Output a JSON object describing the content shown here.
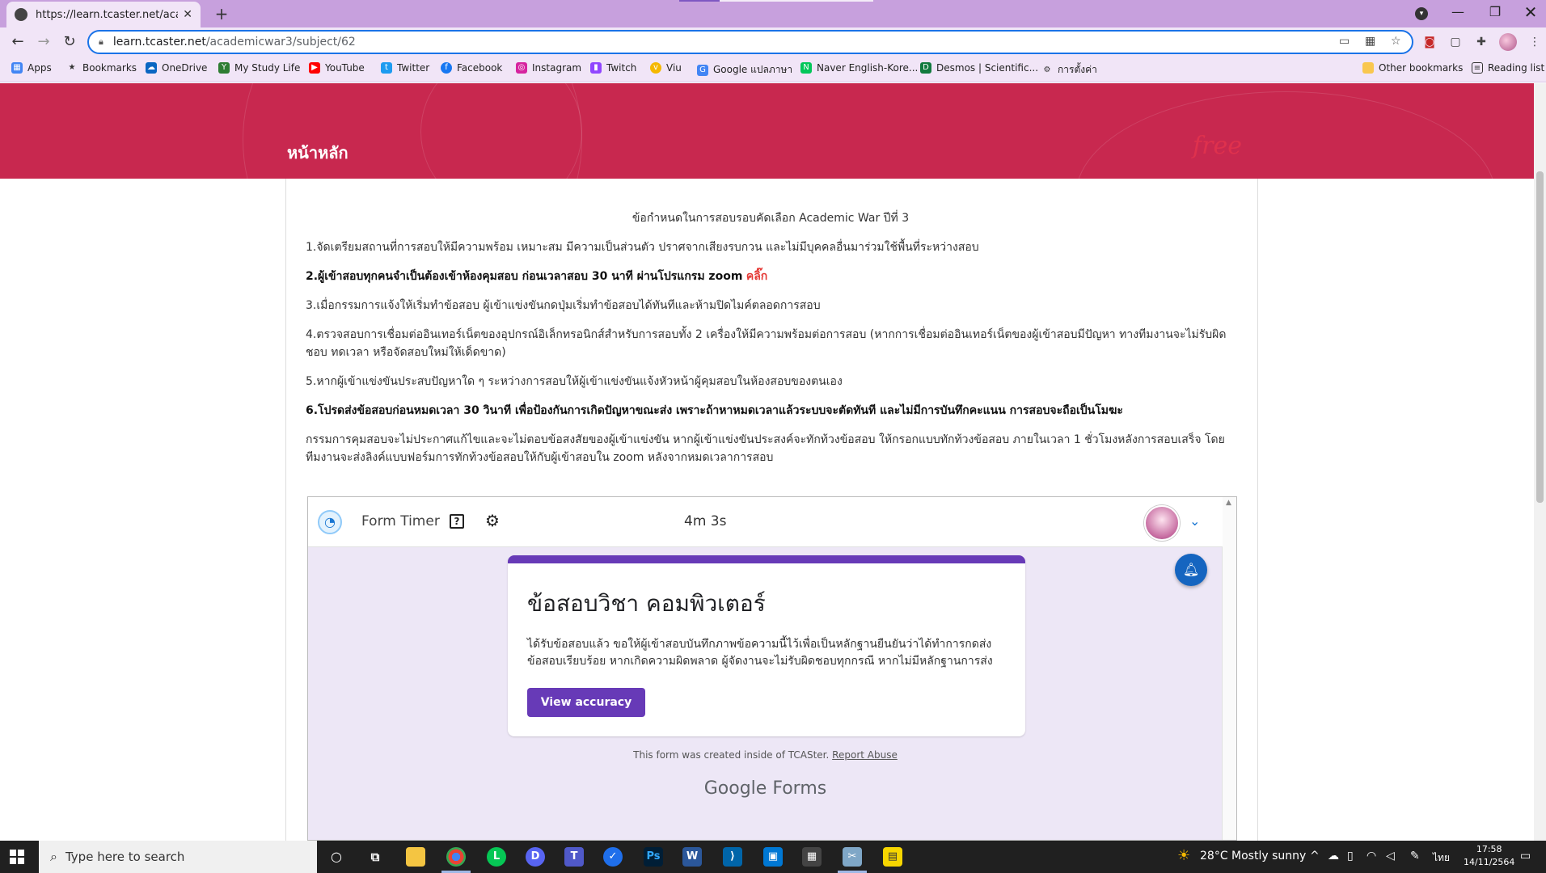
{
  "browser": {
    "tab_title": "https://learn.tcaster.net/academ",
    "url_host": "learn.tcaster.net",
    "url_path": "/academicwar3/subject/62",
    "bookmarks": [
      {
        "label": "Apps",
        "icon": "apps-grid-icon",
        "color": "#4285f4"
      },
      {
        "label": "Bookmarks",
        "icon": "star-icon",
        "color": "#333333"
      },
      {
        "label": "OneDrive",
        "icon": "cloud-icon",
        "color": "#0a66c2"
      },
      {
        "label": "My Study Life",
        "icon": "study-icon",
        "color": "#2e7d32"
      },
      {
        "label": "YouTube",
        "icon": "youtube-icon",
        "color": "#ff0000"
      },
      {
        "label": "Twitter",
        "icon": "twitter-icon",
        "color": "#1d9bf0"
      },
      {
        "label": "Facebook",
        "icon": "facebook-icon",
        "color": "#1877f2"
      },
      {
        "label": "Instagram",
        "icon": "instagram-icon",
        "color": "#d6249f"
      },
      {
        "label": "Twitch",
        "icon": "twitch-icon",
        "color": "#9146ff"
      },
      {
        "label": "Viu",
        "icon": "viu-icon",
        "color": "#f5b800"
      },
      {
        "label": "Google แปลภาษา",
        "icon": "translate-icon",
        "color": "#4285f4"
      },
      {
        "label": "Naver English-Kore...",
        "icon": "naver-icon",
        "color": "#03c75a"
      },
      {
        "label": "Desmos | Scientific...",
        "icon": "desmos-icon",
        "color": "#127a3e"
      },
      {
        "label": "การตั้งค่า",
        "icon": "settings-gear-icon",
        "color": "#333333"
      }
    ],
    "other_bookmarks": "Other bookmarks",
    "reading_list": "Reading list"
  },
  "site": {
    "home": "หน้าหลัก",
    "free_badge": "free"
  },
  "rules": {
    "title": "ข้อกำหนดในการสอบรอบคัดเลือก Academic War ปีที่ 3",
    "r1": "1.จัดเตรียมสถานที่การสอบให้มีความพร้อม เหมาะสม มีความเป็นส่วนตัว ปราศจากเสียงรบกวน และไม่มีบุคคลอื่นมาร่วมใช้พื้นที่ระหว่างสอบ",
    "r2": "2.ผู้เข้าสอบทุกคนจำเป็นต้องเข้าห้องคุมสอบ ก่อนเวลาสอบ 30 นาที ผ่านโปรแกรม zoom",
    "r2_link": "คลิ๊ก",
    "r3": "3.เมื่อกรรมการแจ้งให้เริ่มทำข้อสอบ ผู้เข้าแข่งขันกดปุ่มเริ่มทำข้อสอบได้ทันทีและห้ามปิดไมค์ตลอดการสอบ",
    "r4": "4.ตรวจสอบการเชื่อมต่ออินเทอร์เน็ตของอุปกรณ์อิเล็กทรอนิกส์สำหรับการสอบทั้ง 2 เครื่องให้มีความพร้อมต่อการสอบ (หากการเชื่อมต่ออินเทอร์เน็ตของผู้เข้าสอบมีปัญหา ทางทีมงานจะไม่รับผิดชอบ ทดเวลา หรือจัดสอบใหม่ให้เด็ดขาด)",
    "r5": "5.หากผู้เข้าแข่งขันประสบปัญหาใด ๆ ระหว่างการสอบให้ผู้เข้าแข่งขันแจ้งหัวหน้าผู้คุมสอบในห้องสอบของตนเอง",
    "r6": "6.โปรดส่งข้อสอบก่อนหมดเวลา 30 วินาที เพื่อป้องกันการเกิดปัญหาขณะส่ง เพราะถ้าหาหมดเวลาแล้วระบบจะตัดทันที และไม่มีการบันทึกคะแนน การสอบจะถือเป็นโมฆะ",
    "r7": "กรรมการคุมสอบจะไม่ประกาศแก้ไขและจะไม่ตอบข้อสงสัยของผู้เข้าแข่งขัน หากผู้เข้าแข่งขันประสงค์จะทักท้วงข้อสอบ ให้กรอกแบบทักท้วงข้อสอบ ภายในเวลา 1 ชั่วโมงหลังการสอบเสร็จ โดยทีมงานจะส่งลิงค์แบบฟอร์มการทักท้วงข้อสอบให้กับผู้เข้าสอบใน zoom หลังจากหมดเวลาการสอบ"
  },
  "form_timer": {
    "name": "Form Timer",
    "help": "?",
    "time": "4m 3s"
  },
  "form": {
    "accent": "#673ab7",
    "title": "ข้อสอบวิชา คอมพิวเตอร์",
    "description": "ได้รับข้อสอบแล้ว ขอให้ผู้เข้าสอบบันทึกภาพข้อความนี้ไว้เพื่อเป็นหลักฐานยืนยันว่าได้ทำการกดส่งข้อสอบเรียบร้อย หากเกิดความผิดพลาด ผู้จัดงานจะไม่รับผิดชอบทุกกรณี หากไม่มีหลักฐานการส่ง",
    "view_accuracy": "View accuracy",
    "created_text": "This form was created inside of TCASter.",
    "report_abuse": "Report Abuse",
    "google": "Google",
    "forms": "Forms"
  },
  "taskbar": {
    "search_placeholder": "Type here to search",
    "weather": "28°C  Mostly sunny",
    "lang": "ไทย",
    "time": "17:58",
    "date": "14/11/2564"
  }
}
